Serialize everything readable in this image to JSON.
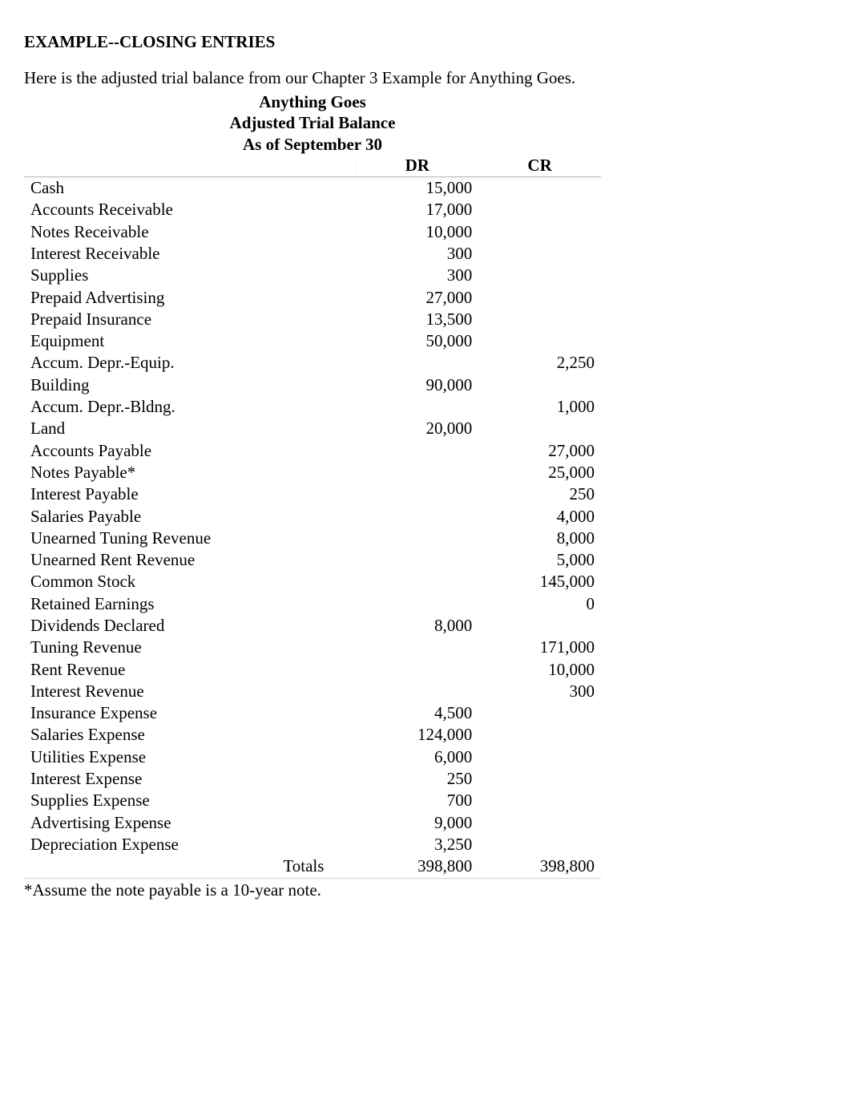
{
  "heading": "EXAMPLE--CLOSING ENTRIES",
  "intro": "Here is the adjusted trial balance from our Chapter 3 Example for Anything Goes.",
  "trial_balance": {
    "title_line1": "Anything Goes",
    "title_line2": "Adjusted Trial Balance",
    "title_line3": "As of September 30",
    "columns": {
      "dr": "DR",
      "cr": "CR"
    },
    "rows": [
      {
        "account": "Cash",
        "dr": "15,000",
        "cr": ""
      },
      {
        "account": "Accounts Receivable",
        "dr": "17,000",
        "cr": ""
      },
      {
        "account": "Notes Receivable",
        "dr": "10,000",
        "cr": ""
      },
      {
        "account": "Interest Receivable",
        "dr": "300",
        "cr": ""
      },
      {
        "account": "Supplies",
        "dr": "300",
        "cr": ""
      },
      {
        "account": "Prepaid Advertising",
        "dr": "27,000",
        "cr": ""
      },
      {
        "account": "Prepaid Insurance",
        "dr": "13,500",
        "cr": ""
      },
      {
        "account": "Equipment",
        "dr": "50,000",
        "cr": ""
      },
      {
        "account": "Accum. Depr.-Equip.",
        "dr": "",
        "cr": "2,250"
      },
      {
        "account": "Building",
        "dr": "90,000",
        "cr": ""
      },
      {
        "account": "Accum. Depr.-Bldng.",
        "dr": "",
        "cr": "1,000"
      },
      {
        "account": "Land",
        "dr": "20,000",
        "cr": ""
      },
      {
        "account": "Accounts Payable",
        "dr": "",
        "cr": "27,000"
      },
      {
        "account": "Notes Payable*",
        "dr": "",
        "cr": "25,000"
      },
      {
        "account": "Interest Payable",
        "dr": "",
        "cr": "250"
      },
      {
        "account": "Salaries Payable",
        "dr": "",
        "cr": "4,000"
      },
      {
        "account": "Unearned Tuning Revenue",
        "dr": "",
        "cr": "8,000"
      },
      {
        "account": "Unearned Rent Revenue",
        "dr": "",
        "cr": "5,000"
      },
      {
        "account": "Common Stock",
        "dr": "",
        "cr": "145,000"
      },
      {
        "account": "Retained Earnings",
        "dr": "",
        "cr": "0"
      },
      {
        "account": "Dividends Declared",
        "dr": "8,000",
        "cr": ""
      },
      {
        "account": "Tuning Revenue",
        "dr": "",
        "cr": "171,000"
      },
      {
        "account": "Rent Revenue",
        "dr": "",
        "cr": "10,000"
      },
      {
        "account": "Interest Revenue",
        "dr": "",
        "cr": "300"
      },
      {
        "account": "Insurance Expense",
        "dr": "4,500",
        "cr": ""
      },
      {
        "account": "Salaries Expense",
        "dr": "124,000",
        "cr": ""
      },
      {
        "account": "Utilities Expense",
        "dr": "6,000",
        "cr": ""
      },
      {
        "account": "Interest Expense",
        "dr": "250",
        "cr": ""
      },
      {
        "account": "Supplies Expense",
        "dr": "700",
        "cr": ""
      },
      {
        "account": "Advertising Expense",
        "dr": "9,000",
        "cr": ""
      },
      {
        "account": "Depreciation Expense",
        "dr": "3,250",
        "cr": ""
      }
    ],
    "totals": {
      "label": "Totals",
      "dr": "398,800",
      "cr": "398,800"
    }
  },
  "footnote": "*Assume the note payable is a 10-year note.",
  "chart_data": {
    "type": "table",
    "title": "Anything Goes — Adjusted Trial Balance — As of September 30",
    "columns": [
      "Account",
      "DR",
      "CR"
    ],
    "rows": [
      [
        "Cash",
        15000,
        null
      ],
      [
        "Accounts Receivable",
        17000,
        null
      ],
      [
        "Notes Receivable",
        10000,
        null
      ],
      [
        "Interest Receivable",
        300,
        null
      ],
      [
        "Supplies",
        300,
        null
      ],
      [
        "Prepaid Advertising",
        27000,
        null
      ],
      [
        "Prepaid Insurance",
        13500,
        null
      ],
      [
        "Equipment",
        50000,
        null
      ],
      [
        "Accum. Depr.-Equip.",
        null,
        2250
      ],
      [
        "Building",
        90000,
        null
      ],
      [
        "Accum. Depr.-Bldng.",
        null,
        1000
      ],
      [
        "Land",
        20000,
        null
      ],
      [
        "Accounts Payable",
        null,
        27000
      ],
      [
        "Notes Payable*",
        null,
        25000
      ],
      [
        "Interest Payable",
        null,
        250
      ],
      [
        "Salaries Payable",
        null,
        4000
      ],
      [
        "Unearned Tuning Revenue",
        null,
        8000
      ],
      [
        "Unearned Rent Revenue",
        null,
        5000
      ],
      [
        "Common Stock",
        null,
        145000
      ],
      [
        "Retained Earnings",
        null,
        0
      ],
      [
        "Dividends Declared",
        8000,
        null
      ],
      [
        "Tuning Revenue",
        null,
        171000
      ],
      [
        "Rent Revenue",
        null,
        10000
      ],
      [
        "Interest Revenue",
        null,
        300
      ],
      [
        "Insurance Expense",
        4500,
        null
      ],
      [
        "Salaries Expense",
        124000,
        null
      ],
      [
        "Utilities Expense",
        6000,
        null
      ],
      [
        "Interest Expense",
        250,
        null
      ],
      [
        "Supplies Expense",
        700,
        null
      ],
      [
        "Advertising Expense",
        9000,
        null
      ],
      [
        "Depreciation Expense",
        3250,
        null
      ]
    ],
    "totals": [
      "Totals",
      398800,
      398800
    ]
  }
}
